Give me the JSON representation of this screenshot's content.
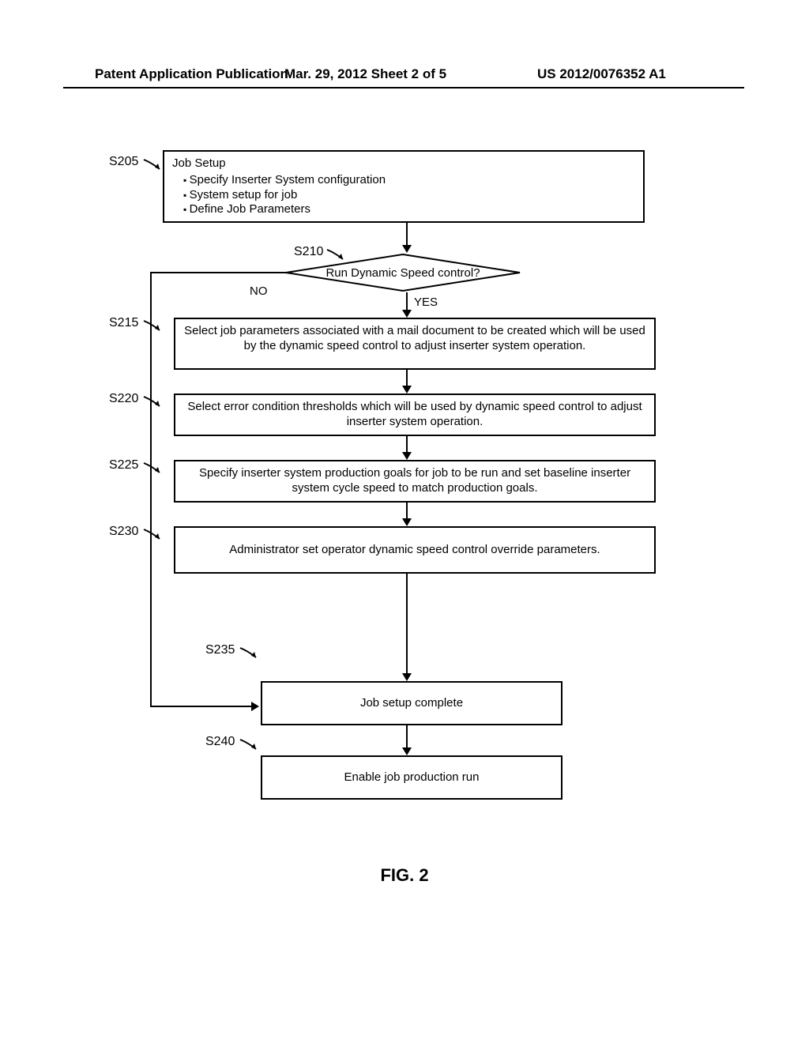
{
  "header": {
    "left": "Patent Application Publication",
    "center": "Mar. 29, 2012  Sheet 2 of 5",
    "right": "US 2012/0076352 A1"
  },
  "labels": {
    "s205": "S205",
    "s210": "S210",
    "s215": "S215",
    "s220": "S220",
    "s225": "S225",
    "s230": "S230",
    "s235": "S235",
    "s240": "S240"
  },
  "steps": {
    "s205": {
      "title": "Job Setup",
      "bullets": [
        "Specify Inserter System configuration",
        "System setup for job",
        "Define Job Parameters"
      ]
    },
    "s210": "Run Dynamic Speed control?",
    "s215": "Select job parameters associated with a mail document to be created which will be used by the dynamic speed control to adjust inserter system operation.",
    "s220": "Select error condition thresholds which will be used by dynamic speed control to adjust inserter system operation.",
    "s225": "Specify inserter system production goals for job to be run and set baseline inserter system cycle speed to match production goals.",
    "s230": "Administrator set operator dynamic speed control override parameters.",
    "s235": "Job setup complete",
    "s240": "Enable job production run"
  },
  "edges": {
    "no": "NO",
    "yes": "YES"
  },
  "figure": "FIG. 2",
  "chart_data": {
    "type": "flowchart",
    "nodes": [
      {
        "id": "S205",
        "type": "process",
        "text": "Job Setup: Specify Inserter System configuration; System setup for job; Define Job Parameters"
      },
      {
        "id": "S210",
        "type": "decision",
        "text": "Run Dynamic Speed control?"
      },
      {
        "id": "S215",
        "type": "process",
        "text": "Select job parameters associated with a mail document to be created which will be used by the dynamic speed control to adjust inserter system operation."
      },
      {
        "id": "S220",
        "type": "process",
        "text": "Select error condition thresholds which will be used by dynamic speed control to adjust inserter system operation."
      },
      {
        "id": "S225",
        "type": "process",
        "text": "Specify inserter system production goals for job to be run and set baseline inserter system cycle speed to match production goals."
      },
      {
        "id": "S230",
        "type": "process",
        "text": "Administrator set operator dynamic speed control override parameters."
      },
      {
        "id": "S235",
        "type": "process",
        "text": "Job setup complete"
      },
      {
        "id": "S240",
        "type": "process",
        "text": "Enable job production run"
      }
    ],
    "edges": [
      {
        "from": "S205",
        "to": "S210"
      },
      {
        "from": "S210",
        "to": "S215",
        "label": "YES"
      },
      {
        "from": "S210",
        "to": "S235",
        "label": "NO"
      },
      {
        "from": "S215",
        "to": "S220"
      },
      {
        "from": "S220",
        "to": "S225"
      },
      {
        "from": "S225",
        "to": "S230"
      },
      {
        "from": "S230",
        "to": "S235"
      },
      {
        "from": "S235",
        "to": "S240"
      }
    ]
  }
}
